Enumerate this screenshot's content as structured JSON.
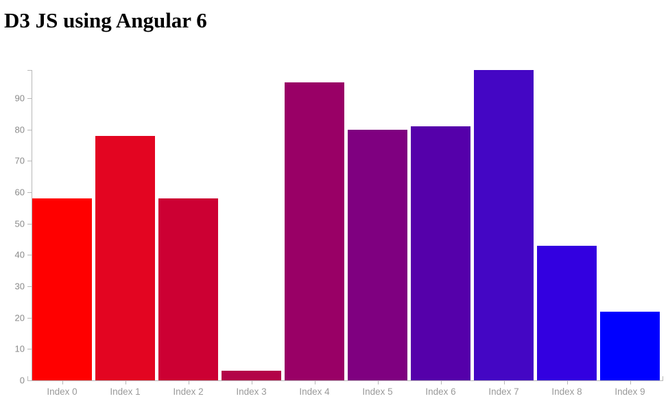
{
  "page": {
    "title": "D3 JS using Angular 6",
    "background_color": "#ffffff"
  },
  "chart_data": {
    "type": "bar",
    "title": "D3 JS using Angular 6",
    "xlabel": "",
    "ylabel": "",
    "categories": [
      "Index 0",
      "Index 1",
      "Index 2",
      "Index 3",
      "Index 4",
      "Index 5",
      "Index 6",
      "Index 7",
      "Index 8",
      "Index 9"
    ],
    "values": [
      58,
      78,
      58,
      3,
      95,
      80,
      81,
      99,
      43,
      22
    ],
    "bar_colors": [
      "#ff0000",
      "#e30521",
      "#cc0033",
      "#b30448",
      "#990066",
      "#7f0080",
      "#5500aa",
      "#4406c4",
      "#3300e0",
      "#0000ff"
    ],
    "ylim": [
      0,
      99
    ],
    "y_ticks": [
      0,
      10,
      20,
      30,
      40,
      50,
      60,
      70,
      80,
      90
    ],
    "y_tick_labels": [
      "0",
      "10",
      "20",
      "30",
      "40",
      "50",
      "60",
      "70",
      "80",
      "90"
    ],
    "x_tick_labels": [
      "Index 0",
      "Index 1",
      "Index 2",
      "Index 3",
      "Index 4",
      "Index 5",
      "Index 6",
      "Index 7",
      "Index 8",
      "Index 9"
    ],
    "grid": false,
    "legend": null,
    "axis_color": "#b7b7b7",
    "tick_label_color": "#8a8a8a"
  }
}
